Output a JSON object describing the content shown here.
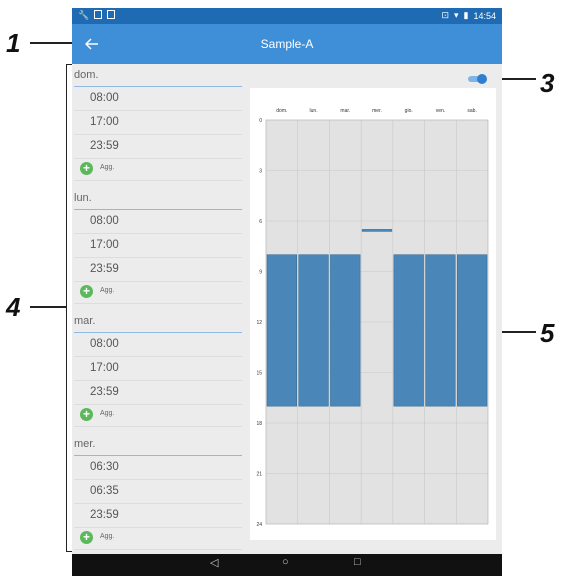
{
  "callouts": [
    "1",
    "3",
    "4",
    "5"
  ],
  "statusbar": {
    "time": "14:54"
  },
  "appbar": {
    "title": "Sample-A",
    "back_icon": "arrow-back-icon"
  },
  "schedule": [
    {
      "day": "dom.",
      "times": [
        "08:00",
        "17:00",
        "23:59"
      ],
      "add_label": "Agg."
    },
    {
      "day": "lun.",
      "times": [
        "08:00",
        "17:00",
        "23:59"
      ],
      "add_label": "Agg."
    },
    {
      "day": "mar.",
      "times": [
        "08:00",
        "17:00",
        "23:59"
      ],
      "add_label": "Agg."
    },
    {
      "day": "mer.",
      "times": [
        "06:30",
        "06:35",
        "23:59"
      ],
      "add_label": "Agg."
    }
  ],
  "toggle": {
    "state": "on",
    "color": "#2f7fd0"
  },
  "chart_data": {
    "type": "bar",
    "categories": [
      "dom.",
      "lun.",
      "mar.",
      "mer.",
      "gio.",
      "ven.",
      "sab."
    ],
    "y_ticks": [
      "0",
      "3",
      "6",
      "9",
      "12",
      "15",
      "18",
      "21",
      "24"
    ],
    "ylim": [
      0,
      24
    ],
    "y_inverted": true,
    "grid": true,
    "bar_color": "#4a86b8",
    "intervals": [
      {
        "day": "dom.",
        "start": 8,
        "end": 17
      },
      {
        "day": "lun.",
        "start": 8,
        "end": 17
      },
      {
        "day": "mar.",
        "start": 8,
        "end": 17
      },
      {
        "day": "mer.",
        "start": 6.5,
        "end": 6.583
      },
      {
        "day": "gio.",
        "start": 8,
        "end": 17
      },
      {
        "day": "ven.",
        "start": 8,
        "end": 17
      },
      {
        "day": "sab.",
        "start": 8,
        "end": 17
      }
    ]
  },
  "navbar": {
    "back": "◁",
    "home": "○",
    "recent": "□"
  }
}
